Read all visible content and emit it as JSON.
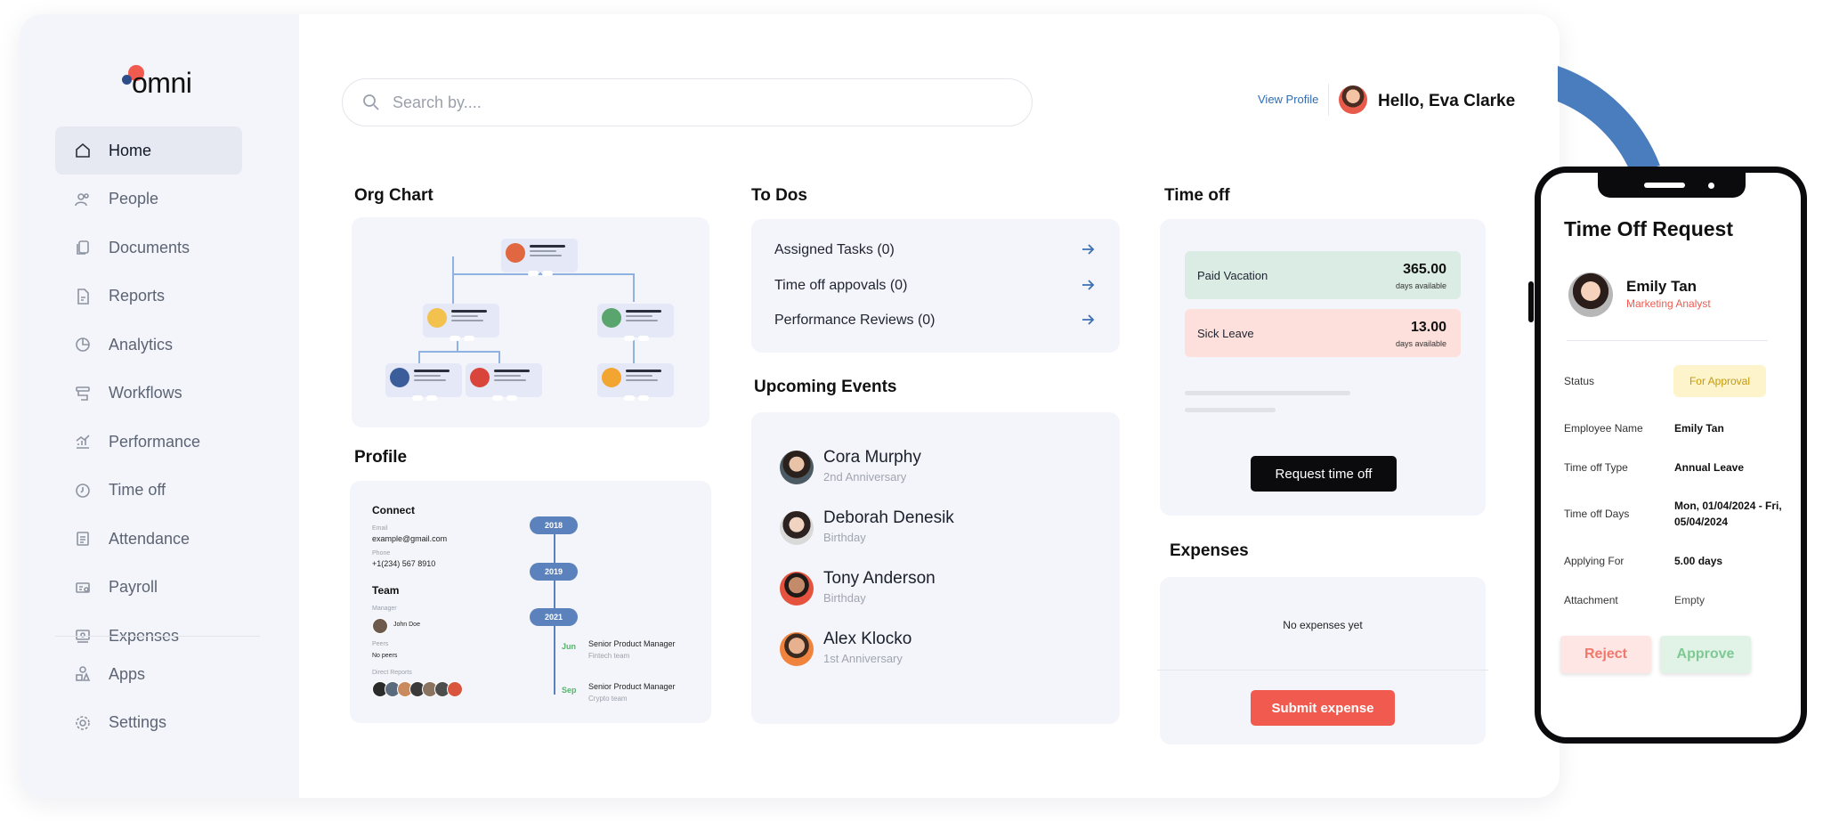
{
  "brand": {
    "name": "omni",
    "accent": "#f05a4f",
    "blue": "#2d4d8a"
  },
  "sidebar": {
    "items": [
      {
        "label": "Home",
        "icon": "home-icon"
      },
      {
        "label": "People",
        "icon": "people-icon"
      },
      {
        "label": "Documents",
        "icon": "documents-icon"
      },
      {
        "label": "Reports",
        "icon": "reports-icon"
      },
      {
        "label": "Analytics",
        "icon": "analytics-icon"
      },
      {
        "label": "Workflows",
        "icon": "workflows-icon"
      },
      {
        "label": "Performance",
        "icon": "performance-icon"
      },
      {
        "label": "Time off",
        "icon": "clock-icon"
      },
      {
        "label": "Attendance",
        "icon": "attendance-icon"
      },
      {
        "label": "Payroll",
        "icon": "payroll-icon"
      },
      {
        "label": "Expenses",
        "icon": "expenses-icon"
      }
    ],
    "bottom_items": [
      {
        "label": "Apps",
        "icon": "apps-icon"
      },
      {
        "label": "Settings",
        "icon": "gear-icon"
      }
    ]
  },
  "header": {
    "search_placeholder": "Search by....",
    "view_profile": "View Profile",
    "greeting": "Hello, Eva Clarke"
  },
  "org_chart": {
    "title": "Org Chart"
  },
  "profile": {
    "title": "Profile",
    "connect": "Connect",
    "email_label": "Email",
    "email": "example@gmail.com",
    "phone_label": "Phone",
    "phone": "+1(234) 567 8910",
    "team": "Team",
    "manager_label": "Manager",
    "manager": "John Doe",
    "peers_label": "Peers",
    "peers": "No peers",
    "direct_reports_label": "Direct Reports",
    "years": [
      "2018",
      "2019",
      "2021"
    ],
    "roles": [
      {
        "month": "Jun",
        "title": "Senior Product Manager",
        "team": "Fintech team"
      },
      {
        "month": "Sep",
        "title": "Senior Product Manager",
        "team": "Crypto team"
      }
    ]
  },
  "todos": {
    "title": "To Dos",
    "items": [
      "Assigned Tasks (0)",
      "Time off appovals (0)",
      "Performance Reviews (0)"
    ]
  },
  "events": {
    "title": "Upcoming Events",
    "items": [
      {
        "name": "Cora Murphy",
        "sub": "2nd Anniversary"
      },
      {
        "name": "Deborah Denesik",
        "sub": "Birthday"
      },
      {
        "name": "Tony Anderson",
        "sub": "Birthday"
      },
      {
        "name": "Alex Klocko",
        "sub": "1st Anniversary"
      }
    ]
  },
  "time_off": {
    "title": "Time off",
    "paid": {
      "label": "Paid Vacation",
      "value": "365.00",
      "sub": "days available"
    },
    "sick": {
      "label": "Sick Leave",
      "value": "13.00",
      "sub": "days available"
    },
    "button": "Request time off"
  },
  "expenses": {
    "title": "Expenses",
    "empty": "No expenses yet",
    "button": "Submit expense"
  },
  "phone": {
    "title": "Time Off Request",
    "name": "Emily Tan",
    "role": "Marketing Analyst",
    "status_label": "Status",
    "status": "For Approval",
    "employee_label": "Employee Name",
    "employee": "Emily Tan",
    "type_label": "Time off Type",
    "type": "Annual Leave",
    "days_label": "Time off Days",
    "days_line1": "Mon, 01/04/2024 - Fri,",
    "days_line2": "05/04/2024",
    "applying_label": "Applying For",
    "applying": "5.00 days",
    "attachment_label": "Attachment",
    "attachment": "Empty",
    "reject": "Reject",
    "approve": "Approve"
  }
}
